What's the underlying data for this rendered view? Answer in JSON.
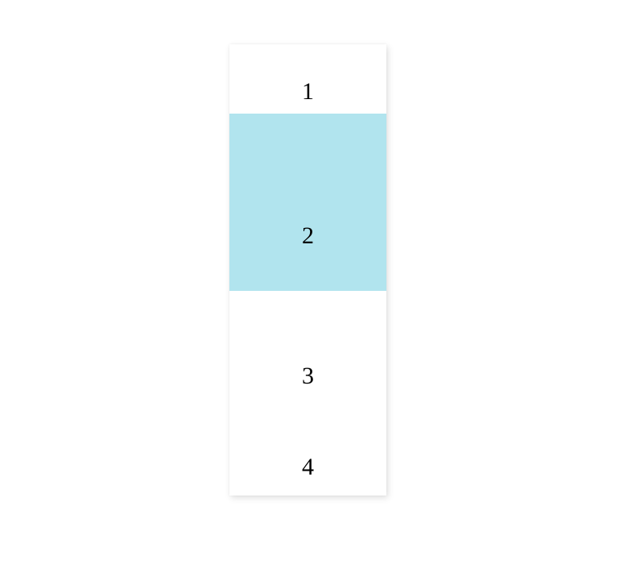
{
  "items": [
    {
      "label": "1",
      "highlighted": false
    },
    {
      "label": "2",
      "highlighted": true
    },
    {
      "label": "3",
      "highlighted": false
    },
    {
      "label": "4",
      "highlighted": false
    }
  ],
  "colors": {
    "highlight": "#b1e4ee",
    "background": "#ffffff"
  }
}
